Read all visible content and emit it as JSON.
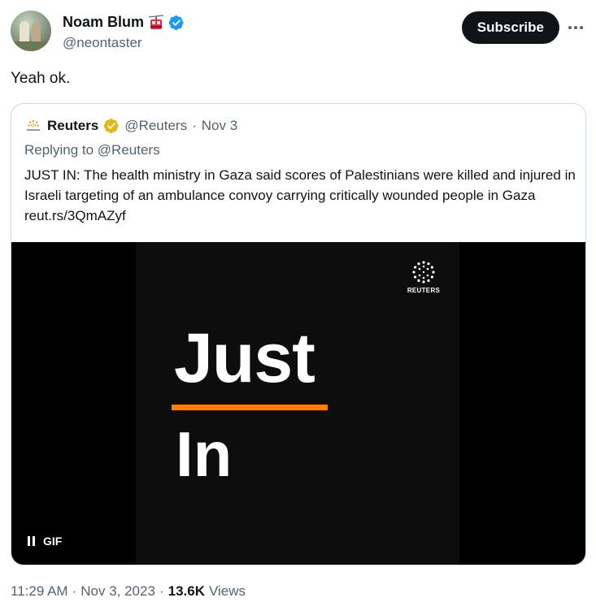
{
  "author": {
    "display_name": "Noam Blum",
    "handle": "@neontaster"
  },
  "actions": {
    "subscribe_label": "Subscribe"
  },
  "tweet": {
    "text": "Yeah ok."
  },
  "quoted": {
    "name": "Reuters",
    "handle": "@Reuters",
    "separator": "·",
    "date": "Nov 3",
    "replying_prefix": "Replying to ",
    "replying_handle": "@Reuters",
    "body": "JUST IN: The health ministry in Gaza said scores of Palestinians were killed and injured in Israeli targeting of an ambulance convoy carrying critically wounded people in Gaza reut.rs/3QmAZyf",
    "media": {
      "headline_top": "Just",
      "headline_bottom": "In",
      "brand_label": "REUTERS",
      "gif_label": "GIF",
      "accent_color": "#ff8000"
    }
  },
  "footer": {
    "time": "11:29 AM",
    "dot1": "·",
    "date": "Nov 3, 2023",
    "dot2": "·",
    "views_count": "13.6K",
    "views_label": "Views"
  },
  "colors": {
    "text_primary": "#0f1419",
    "text_secondary": "#536471",
    "verified_blue": "#1d9bf0",
    "verified_gold": "#e2b719",
    "border": "#cfd9de"
  },
  "icons": {
    "emoji": "aerial-tramway-icon",
    "verified": "verified-badge-icon",
    "more": "more-horizontal-icon",
    "quoted_avatar": "reuters-logo-icon",
    "quoted_verified": "gold-verified-badge-icon",
    "pause": "pause-icon"
  }
}
